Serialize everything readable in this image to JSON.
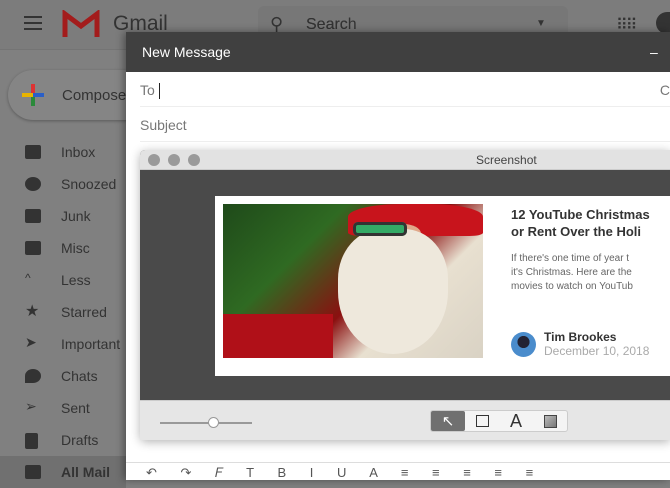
{
  "header": {
    "app_name": "Gmail",
    "search_placeholder": "Search",
    "search_visible": "Searc"
  },
  "compose_button": "Compose",
  "sidebar": {
    "items": [
      {
        "label": "Inbox",
        "icon": "inbox-icon"
      },
      {
        "label": "Snoozed",
        "icon": "clock-icon"
      },
      {
        "label": "Junk",
        "icon": "label-icon"
      },
      {
        "label": "Misc",
        "icon": "label-icon"
      },
      {
        "label": "Less",
        "icon": "chevron-up-icon"
      },
      {
        "label": "Starred",
        "icon": "star-icon"
      },
      {
        "label": "Important",
        "icon": "important-icon"
      },
      {
        "label": "Chats",
        "icon": "chat-icon"
      },
      {
        "label": "Sent",
        "icon": "send-icon"
      },
      {
        "label": "Drafts",
        "icon": "draft-icon"
      },
      {
        "label": "All Mail",
        "icon": "mail-icon",
        "active": true
      }
    ]
  },
  "compose": {
    "title": "New Message",
    "minimize": "–",
    "to_label": "To",
    "cc_label": "C",
    "subject_placeholder": "Subject"
  },
  "screenshot_window": {
    "title": "Screenshot"
  },
  "article": {
    "title_line1": "12 YouTube Christmas",
    "title_line2": "or Rent Over the Holi",
    "desc_line1": "If there's one time of year t",
    "desc_line2": "it's Christmas. Here are the",
    "desc_line3": "movies to watch on YouTub",
    "author": "Tim Brookes",
    "date": "December 10, 2018"
  },
  "tools": {
    "text_tool": "A"
  },
  "format_toolbar": "↶ ↷ 𝐹 T B I U A ≡ ≡ ≡ ≡ ≡"
}
